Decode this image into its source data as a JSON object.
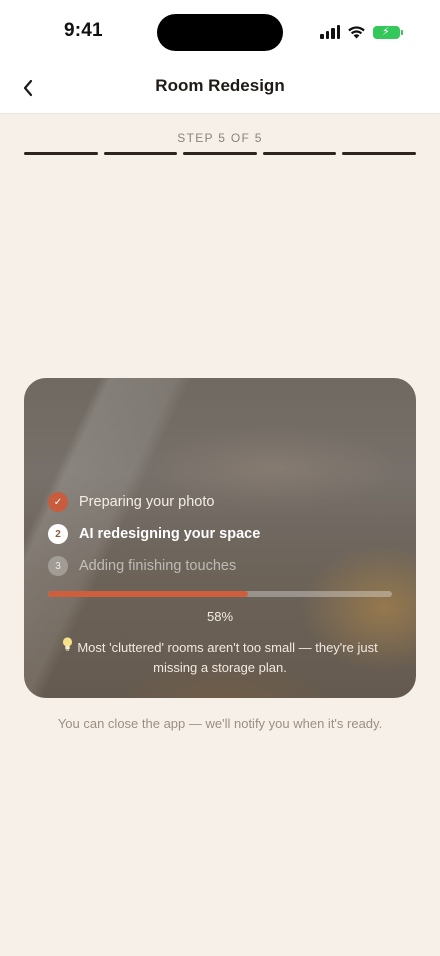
{
  "status_bar": {
    "time": "9:41",
    "icons": [
      "signal-icon",
      "wifi-icon",
      "battery-charging-icon"
    ],
    "battery_color": "#34c759"
  },
  "nav": {
    "title": "Room Redesign",
    "back_icon": "chevron-left-icon"
  },
  "wizard": {
    "step_label": "STEP 5 OF 5",
    "total_steps": 5,
    "completed_steps": 5
  },
  "progress_card": {
    "steps": [
      {
        "badge": "✓",
        "label": "Preparing your photo",
        "state": "done"
      },
      {
        "badge": "2",
        "label": "AI redesigning your space",
        "state": "active"
      },
      {
        "badge": "3",
        "label": "Adding finishing touches",
        "state": "pending"
      }
    ],
    "progress_fraction": 0.58,
    "progress_text": "58%",
    "tip_icon": "lightbulb-icon",
    "tip_text": "Most 'cluttered' rooms aren't too small — they're just missing a storage plan."
  },
  "footer_note": "You can close the app — we'll notify you when it's ready.",
  "colors": {
    "accent": "#cf5f3c",
    "background": "#f7f0e8"
  }
}
